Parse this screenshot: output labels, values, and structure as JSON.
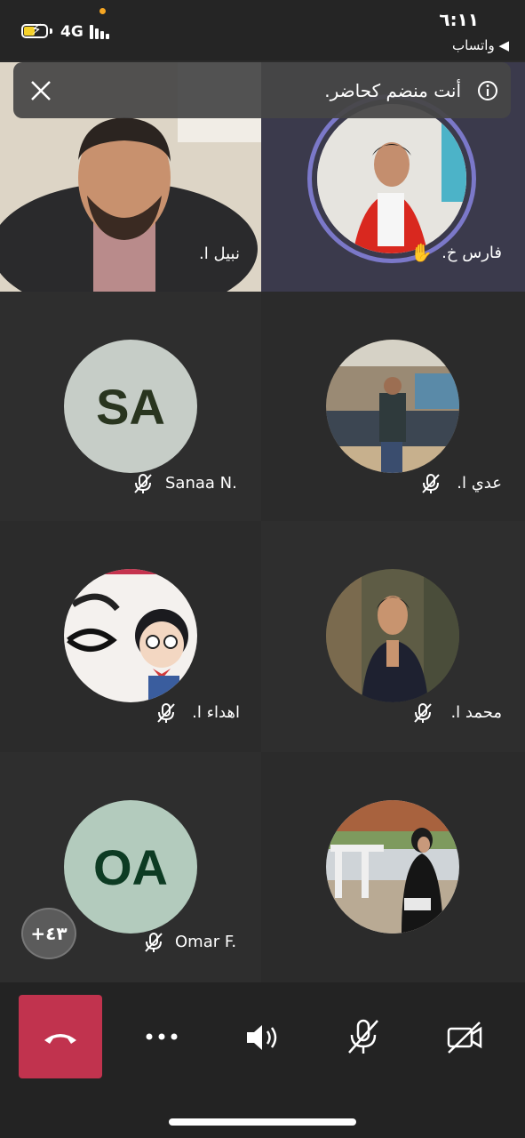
{
  "status_bar": {
    "network": "4G",
    "time": "٦:١١",
    "back_app": "◀ واتساب"
  },
  "banner": {
    "text": "أنت منضم كحاضر."
  },
  "participants": [
    {
      "name": "نبيل ا.",
      "type": "video",
      "muted": false
    },
    {
      "name": "فارس خ.",
      "type": "photo",
      "muted": false,
      "hand_raised": true,
      "active_speaker": true
    },
    {
      "name": "Sanaa N.",
      "type": "initials",
      "initials": "SA",
      "muted": true
    },
    {
      "name": "عدي ا.",
      "type": "photo",
      "muted": true
    },
    {
      "name": "اهداء ا.",
      "type": "photo",
      "muted": true
    },
    {
      "name": "محمد ا.",
      "type": "photo",
      "muted": true
    },
    {
      "name": "Omar F.",
      "type": "initials",
      "initials": "OA",
      "muted": true
    },
    {
      "name": "",
      "type": "photo",
      "muted": false
    }
  ],
  "overflow_count": "+٤٣",
  "colors": {
    "sa_bg": "#c6cdc7",
    "sa_text": "#29351f",
    "oa_bg": "#b3cbbd",
    "oa_text": "#0d3b23",
    "hangup": "#c1334e",
    "speaker_ring": "#7b78c9"
  },
  "controls": [
    {
      "name": "hang-up",
      "icon": "phone-hangup-icon"
    },
    {
      "name": "more",
      "icon": "more-icon"
    },
    {
      "name": "speaker",
      "icon": "speaker-icon"
    },
    {
      "name": "mic-off",
      "icon": "mic-off-icon"
    },
    {
      "name": "camera-off",
      "icon": "camera-off-icon"
    }
  ]
}
